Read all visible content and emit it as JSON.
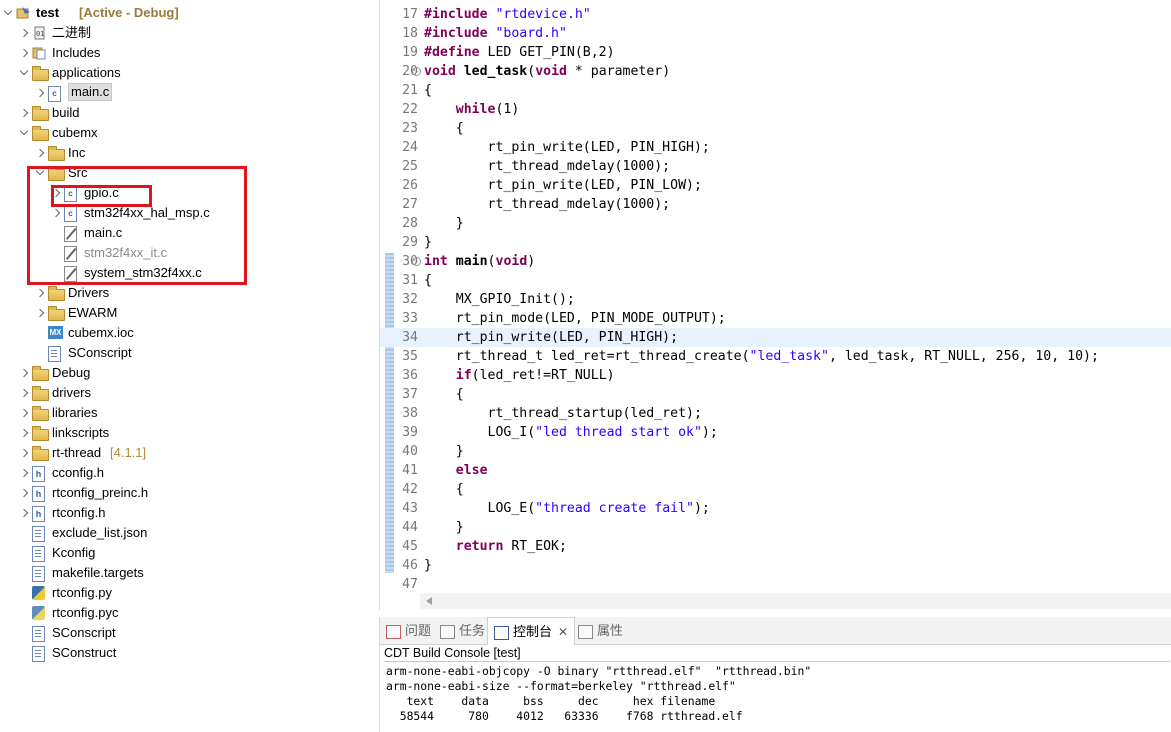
{
  "explorer": {
    "project": {
      "name": "test",
      "status": "[Active - Debug]"
    },
    "items": [
      {
        "label": "二进制"
      },
      {
        "label": "Includes"
      },
      {
        "label": "applications"
      },
      {
        "label": "main.c"
      },
      {
        "label": "build"
      },
      {
        "label": "cubemx"
      },
      {
        "label": "Inc"
      },
      {
        "label": "Src"
      },
      {
        "label": "gpio.c"
      },
      {
        "label": "stm32f4xx_hal_msp.c"
      },
      {
        "label": "main.c"
      },
      {
        "label": "stm32f4xx_it.c"
      },
      {
        "label": "system_stm32f4xx.c"
      },
      {
        "label": "Drivers"
      },
      {
        "label": "EWARM"
      },
      {
        "label": "cubemx.ioc"
      },
      {
        "label": "SConscript"
      },
      {
        "label": "Debug"
      },
      {
        "label": "drivers"
      },
      {
        "label": "libraries"
      },
      {
        "label": "linkscripts"
      },
      {
        "label": "rt-thread",
        "suffix": "[4.1.1]"
      },
      {
        "label": "cconfig.h"
      },
      {
        "label": "rtconfig_preinc.h"
      },
      {
        "label": "rtconfig.h"
      },
      {
        "label": "exclude_list.json"
      },
      {
        "label": "Kconfig"
      },
      {
        "label": "makefile.targets"
      },
      {
        "label": "rtconfig.py"
      },
      {
        "label": "rtconfig.pyc"
      },
      {
        "label": "SConscript"
      },
      {
        "label": "SConstruct"
      }
    ]
  },
  "editor": {
    "lines": [
      {
        "n": "17",
        "segs": [
          {
            "k": "kw",
            "t": "#include"
          },
          {
            "t": " "
          },
          {
            "k": "str",
            "t": "\"rtdevice.h\""
          }
        ]
      },
      {
        "n": "18",
        "segs": [
          {
            "k": "kw",
            "t": "#include"
          },
          {
            "t": " "
          },
          {
            "k": "str",
            "t": "\"board.h\""
          }
        ]
      },
      {
        "n": "19",
        "segs": [
          {
            "k": "kw",
            "t": "#define"
          },
          {
            "t": " LED GET_PIN(B,2)"
          }
        ]
      },
      {
        "n": "20",
        "fold": true,
        "segs": [
          {
            "k": "kw",
            "t": "void"
          },
          {
            "t": " "
          },
          {
            "k": "b",
            "t": "led_task"
          },
          {
            "t": "("
          },
          {
            "k": "kw",
            "t": "void"
          },
          {
            "t": " * parameter)"
          }
        ]
      },
      {
        "n": "21",
        "segs": [
          {
            "t": "{"
          }
        ]
      },
      {
        "n": "22",
        "segs": [
          {
            "t": "    "
          },
          {
            "k": "kw",
            "t": "while"
          },
          {
            "t": "(1)"
          }
        ]
      },
      {
        "n": "23",
        "segs": [
          {
            "t": "    {"
          }
        ]
      },
      {
        "n": "24",
        "segs": [
          {
            "t": "        rt_pin_write(LED, PIN_HIGH);"
          }
        ]
      },
      {
        "n": "25",
        "segs": [
          {
            "t": "        rt_thread_mdelay(1000);"
          }
        ]
      },
      {
        "n": "26",
        "segs": [
          {
            "t": "        rt_pin_write(LED, PIN_LOW);"
          }
        ]
      },
      {
        "n": "27",
        "segs": [
          {
            "t": "        rt_thread_mdelay(1000);"
          }
        ]
      },
      {
        "n": "28",
        "segs": [
          {
            "t": "    }"
          }
        ]
      },
      {
        "n": "29",
        "segs": [
          {
            "t": "}"
          }
        ]
      },
      {
        "n": "30",
        "fold": true,
        "segs": [
          {
            "k": "kw",
            "t": "int"
          },
          {
            "t": " "
          },
          {
            "k": "b",
            "t": "main"
          },
          {
            "t": "("
          },
          {
            "k": "kw",
            "t": "void"
          },
          {
            "t": ")"
          }
        ]
      },
      {
        "n": "31",
        "segs": [
          {
            "t": "{"
          }
        ]
      },
      {
        "n": "32",
        "segs": [
          {
            "t": "    MX_GPIO_Init();"
          }
        ]
      },
      {
        "n": "33",
        "segs": [
          {
            "t": "    rt_pin_mode(LED, PIN_MODE_OUTPUT);"
          }
        ]
      },
      {
        "n": "34",
        "current": true,
        "segs": [
          {
            "t": "    rt_pin_write(LED, PIN_HIGH);"
          }
        ]
      },
      {
        "n": "35",
        "segs": [
          {
            "t": "    rt_thread_t led_ret=rt_thread_create("
          },
          {
            "k": "str",
            "t": "\"led_task\""
          },
          {
            "t": ", led_task, RT_NULL, 256, 10, 10);"
          }
        ]
      },
      {
        "n": "36",
        "segs": [
          {
            "t": "    "
          },
          {
            "k": "kw",
            "t": "if"
          },
          {
            "t": "(led_ret!=RT_NULL)"
          }
        ]
      },
      {
        "n": "37",
        "segs": [
          {
            "t": "    {"
          }
        ]
      },
      {
        "n": "38",
        "segs": [
          {
            "t": "        rt_thread_startup(led_ret);"
          }
        ]
      },
      {
        "n": "39",
        "segs": [
          {
            "t": "        LOG_I("
          },
          {
            "k": "str",
            "t": "\"led thread start ok\""
          },
          {
            "t": ");"
          }
        ]
      },
      {
        "n": "40",
        "segs": [
          {
            "t": "    }"
          }
        ]
      },
      {
        "n": "41",
        "segs": [
          {
            "t": "    "
          },
          {
            "k": "kw",
            "t": "else"
          }
        ]
      },
      {
        "n": "42",
        "segs": [
          {
            "t": "    {"
          }
        ]
      },
      {
        "n": "43",
        "segs": [
          {
            "t": "        LOG_E("
          },
          {
            "k": "str",
            "t": "\"thread create fail\""
          },
          {
            "t": ");"
          }
        ]
      },
      {
        "n": "44",
        "segs": [
          {
            "t": "    }"
          }
        ]
      },
      {
        "n": "45",
        "segs": [
          {
            "t": "    "
          },
          {
            "k": "kw",
            "t": "return"
          },
          {
            "t": " RT_EOK;"
          }
        ]
      },
      {
        "n": "46",
        "segs": [
          {
            "t": "}"
          }
        ]
      },
      {
        "n": "47",
        "segs": []
      }
    ]
  },
  "console": {
    "tabs": [
      "问题",
      "任务",
      "控制台",
      "属性"
    ],
    "title": "CDT Build Console [test]",
    "lines": [
      "arm-none-eabi-objcopy -O binary \"rtthread.elf\"  \"rtthread.bin\"",
      "arm-none-eabi-size --format=berkeley \"rtthread.elf\"",
      "   text    data     bss     dec     hex filename",
      "  58544     780    4012   63336    f768 rtthread.elf"
    ]
  },
  "colors": {
    "keyword": "#7f0055",
    "string": "#2a00ff",
    "highlight_box": "#e0141e",
    "current_line": "#e8f2fe"
  }
}
